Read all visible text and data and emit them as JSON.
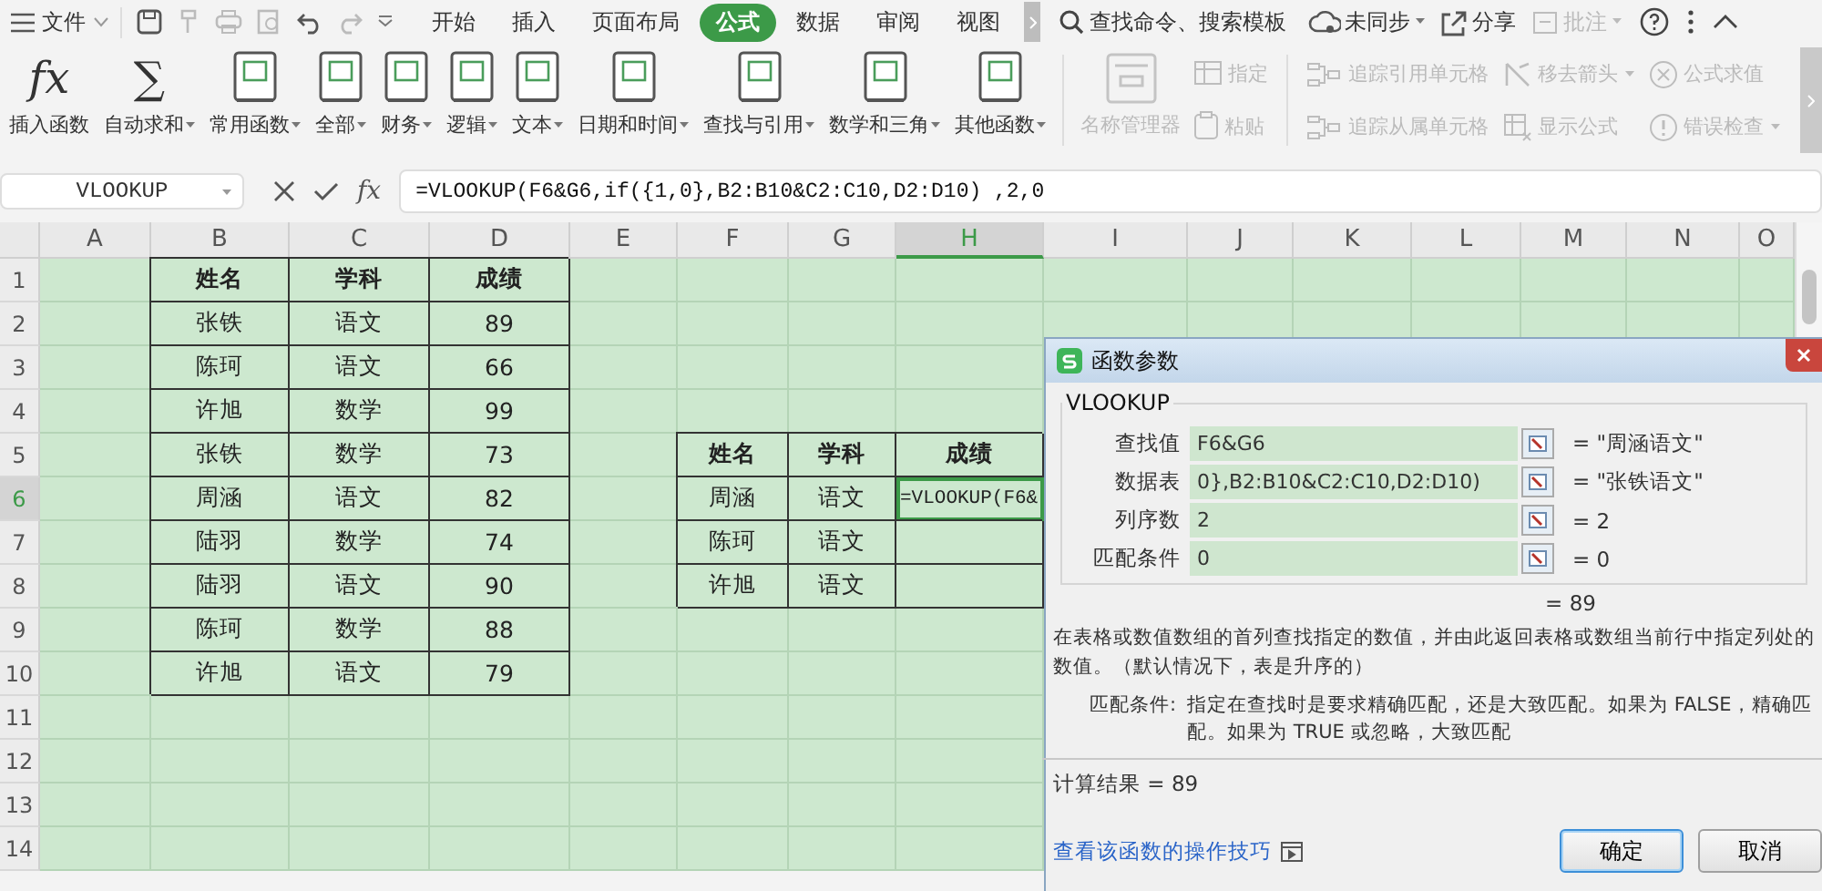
{
  "menu_bar": {
    "file": "文件",
    "tabs": [
      {
        "label": "开始",
        "selected": false
      },
      {
        "label": "插入",
        "selected": false
      },
      {
        "label": "页面布局",
        "selected": false
      },
      {
        "label": "公式",
        "selected": true
      },
      {
        "label": "数据",
        "selected": false
      },
      {
        "label": "审阅",
        "selected": false
      },
      {
        "label": "视图",
        "selected": false
      }
    ],
    "search": "查找命令、搜索模板",
    "actions": [
      {
        "kind": "sync",
        "label": "未同步",
        "dropdown": true,
        "disabled": false
      },
      {
        "kind": "share",
        "label": "分享",
        "dropdown": false,
        "disabled": false
      },
      {
        "kind": "comment",
        "label": "批注",
        "dropdown": true,
        "disabled": true
      }
    ]
  },
  "ribbon": {
    "function_buttons": [
      {
        "kind": "glyph",
        "glyph": "fx",
        "label": "插入函数",
        "dropdown": false
      },
      {
        "kind": "glyph",
        "glyph": "∑",
        "label": "自动求和",
        "dropdown": true
      },
      {
        "kind": "book",
        "label": "常用函数",
        "dropdown": true
      },
      {
        "kind": "book",
        "label": "全部",
        "dropdown": true
      },
      {
        "kind": "book",
        "label": "财务",
        "dropdown": true
      },
      {
        "kind": "book",
        "label": "逻辑",
        "dropdown": true
      },
      {
        "kind": "book",
        "label": "文本",
        "dropdown": true
      },
      {
        "kind": "book",
        "label": "日期和时间",
        "dropdown": true
      },
      {
        "kind": "book",
        "label": "查找与引用",
        "dropdown": true
      },
      {
        "kind": "book",
        "label": "数学和三角",
        "dropdown": true
      },
      {
        "kind": "book",
        "label": "其他函数",
        "dropdown": true
      }
    ],
    "name_manager": {
      "label": "名称管理器",
      "disabled": true
    },
    "small_buttons": [
      {
        "kind": "table",
        "label": "指定",
        "disabled": true
      },
      {
        "kind": "clipboard",
        "label": "粘贴",
        "disabled": true
      }
    ],
    "audit_buttons": [
      {
        "kind": "trace",
        "label": "追踪引用单元格",
        "dropdown": false,
        "disabled": true
      },
      {
        "kind": "arrow",
        "label": "移去箭头",
        "dropdown": true,
        "disabled": true
      },
      {
        "kind": "evaluate",
        "label": "公式求值",
        "dropdown": false,
        "disabled": true
      },
      {
        "kind": "trace",
        "label": "追踪从属单元格",
        "dropdown": false,
        "disabled": true
      },
      {
        "kind": "show",
        "label": "显示公式",
        "dropdown": false,
        "disabled": true
      },
      {
        "kind": "error",
        "label": "错误检查",
        "dropdown": true,
        "disabled": true
      }
    ]
  },
  "formula_bar": {
    "name_box": "VLOOKUP",
    "fx": "fx",
    "formula": "=VLOOKUP(F6&G6,if({1,0},B2:B10&C2:C10,D2:D10) ,2,0"
  },
  "sheet": {
    "columns": [
      {
        "label": "A",
        "selected": false
      },
      {
        "label": "B",
        "selected": false
      },
      {
        "label": "C",
        "selected": false
      },
      {
        "label": "D",
        "selected": false
      },
      {
        "label": "E",
        "selected": false
      },
      {
        "label": "F",
        "selected": false
      },
      {
        "label": "G",
        "selected": false
      },
      {
        "label": "H",
        "selected": true
      },
      {
        "label": "I",
        "selected": false
      },
      {
        "label": "J",
        "selected": false
      },
      {
        "label": "K",
        "selected": false
      },
      {
        "label": "L",
        "selected": false
      },
      {
        "label": "M",
        "selected": false
      },
      {
        "label": "N",
        "selected": false
      },
      {
        "label": "O",
        "selected": false
      }
    ],
    "rows": [
      {
        "label": "1",
        "selected": false,
        "cells": [
          {
            "kind": "blank"
          },
          {
            "kind": "header",
            "text": "姓名"
          },
          {
            "kind": "header",
            "text": "学科"
          },
          {
            "kind": "header",
            "text": "成绩"
          }
        ]
      },
      {
        "label": "2",
        "selected": false,
        "cells": [
          {
            "kind": "blank"
          },
          {
            "kind": "data",
            "text": "张铁"
          },
          {
            "kind": "data",
            "text": "语文"
          },
          {
            "kind": "data",
            "text": "89"
          }
        ]
      },
      {
        "label": "3",
        "selected": false,
        "cells": [
          {
            "kind": "blank"
          },
          {
            "kind": "data",
            "text": "陈珂"
          },
          {
            "kind": "data",
            "text": "语文"
          },
          {
            "kind": "data",
            "text": "66"
          }
        ]
      },
      {
        "label": "4",
        "selected": false,
        "cells": [
          {
            "kind": "blank"
          },
          {
            "kind": "data",
            "text": "许旭"
          },
          {
            "kind": "data",
            "text": "数学"
          },
          {
            "kind": "data",
            "text": "99"
          }
        ]
      },
      {
        "label": "5",
        "selected": false,
        "cells": [
          {
            "kind": "blank"
          },
          {
            "kind": "data",
            "text": "张铁"
          },
          {
            "kind": "data",
            "text": "数学"
          },
          {
            "kind": "data",
            "text": "73"
          },
          {
            "kind": "blank"
          },
          {
            "kind": "header",
            "text": "姓名"
          },
          {
            "kind": "header",
            "text": "学科"
          },
          {
            "kind": "header",
            "text": "成绩"
          }
        ]
      },
      {
        "label": "6",
        "selected": true,
        "cells": [
          {
            "kind": "blank"
          },
          {
            "kind": "data",
            "text": "周涵"
          },
          {
            "kind": "data",
            "text": "语文"
          },
          {
            "kind": "data",
            "text": "82"
          },
          {
            "kind": "blank"
          },
          {
            "kind": "data",
            "text": "周涵"
          },
          {
            "kind": "data",
            "text": "语文"
          },
          {
            "kind": "formula",
            "text": "=VLOOKUP(F6&"
          }
        ]
      },
      {
        "label": "7",
        "selected": false,
        "cells": [
          {
            "kind": "blank"
          },
          {
            "kind": "data",
            "text": "陆羽"
          },
          {
            "kind": "data",
            "text": "数学"
          },
          {
            "kind": "data",
            "text": "74"
          },
          {
            "kind": "blank"
          },
          {
            "kind": "data",
            "text": "陈珂"
          },
          {
            "kind": "data",
            "text": "语文"
          },
          {
            "kind": "data"
          }
        ]
      },
      {
        "label": "8",
        "selected": false,
        "cells": [
          {
            "kind": "blank"
          },
          {
            "kind": "data",
            "text": "陆羽"
          },
          {
            "kind": "data",
            "text": "语文"
          },
          {
            "kind": "data",
            "text": "90"
          },
          {
            "kind": "blank"
          },
          {
            "kind": "data",
            "text": "许旭"
          },
          {
            "kind": "data",
            "text": "语文"
          },
          {
            "kind": "data"
          }
        ]
      },
      {
        "label": "9",
        "selected": false,
        "cells": [
          {
            "kind": "blank"
          },
          {
            "kind": "data",
            "text": "陈珂"
          },
          {
            "kind": "data",
            "text": "数学"
          },
          {
            "kind": "data",
            "text": "88"
          }
        ]
      },
      {
        "label": "10",
        "selected": false,
        "cells": [
          {
            "kind": "blank"
          },
          {
            "kind": "data",
            "text": "许旭"
          },
          {
            "kind": "data",
            "text": "语文"
          },
          {
            "kind": "data",
            "text": "79"
          }
        ]
      },
      {
        "label": "11",
        "selected": false
      },
      {
        "label": "12",
        "selected": false
      },
      {
        "label": "13",
        "selected": false
      },
      {
        "label": "14",
        "selected": false
      }
    ]
  },
  "dialog": {
    "title": "函数参数",
    "function": "VLOOKUP",
    "params": [
      {
        "label": "查找值",
        "value": "F6&G6",
        "result": "= \"周涵语文\""
      },
      {
        "label": "数据表",
        "value": "0},B2:B10&C2:C10,D2:D10)",
        "result": "= \"张铁语文\""
      },
      {
        "label": "列序数",
        "value": "2",
        "result": "= 2"
      },
      {
        "label": "匹配条件",
        "value": "0",
        "result": "= 0"
      }
    ],
    "result_preview": "= 89",
    "description": [
      "在表格或数值数组的首列查找指定的数值，并由此返回表格或数组当前行中指定列处的",
      "数值。（默认情况下，表是升序的）"
    ],
    "param_help": {
      "label": "匹配条件:",
      "lines": [
        "指定在查找时是要求精确匹配，还是大致匹配。如果为 FALSE，精确匹",
        "配。如果为 TRUE 或忽略，大致匹配"
      ]
    },
    "calc_result": "计算结果 = 89",
    "link": "查看该函数的操作技巧",
    "buttons": [
      {
        "label": "确定",
        "default": true
      },
      {
        "label": "取消",
        "default": false
      }
    ]
  }
}
